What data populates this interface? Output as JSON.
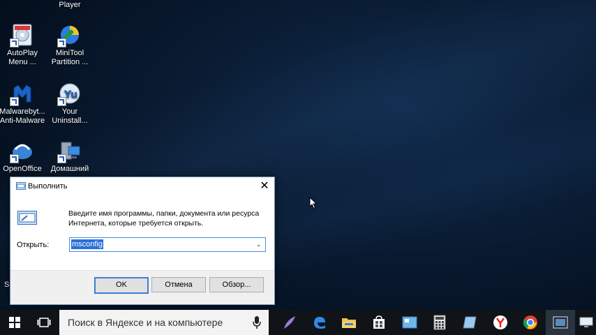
{
  "desktop": {
    "partial_top_label": "Player",
    "icons": [
      {
        "label": "AutoPlay Menu ...",
        "icon": "autoplay-menu-icon"
      },
      {
        "label": "MiniTool Partition ...",
        "icon": "minitool-partition-icon"
      },
      {
        "label": "Malwarebyt... Anti-Malware",
        "icon": "malwarebytes-icon"
      },
      {
        "label": "Your Uninstall...",
        "icon": "your-uninstaller-icon"
      },
      {
        "label": "OpenOffice",
        "icon": "openoffice-icon"
      },
      {
        "label": "Домашний",
        "icon": "homegroup-icon"
      }
    ],
    "partial_behind_label": "S"
  },
  "run_dialog": {
    "title": "Выполнить",
    "description": "Введите имя программы, папки, документа или ресурса Интернета, которые требуется открыть.",
    "open_label": "Открыть:",
    "input_value": "msconfig",
    "ok_label": "OK",
    "cancel_label": "Отмена",
    "browse_label": "Обзор..."
  },
  "taskbar": {
    "search_placeholder": "Поиск в Яндексе и на компьютере",
    "pinned": [
      "start-icon",
      "task-view-icon",
      "feather-icon",
      "edge-icon",
      "file-explorer-icon",
      "store-icon",
      "photos-icon",
      "calculator-icon",
      "notes-icon",
      "yandex-browser-icon",
      "chrome-icon",
      "media-icon",
      "display-icon"
    ]
  },
  "colors": {
    "accent": "#2b6fd6",
    "taskbar": "#101418",
    "desktop": "#0a1c33"
  }
}
